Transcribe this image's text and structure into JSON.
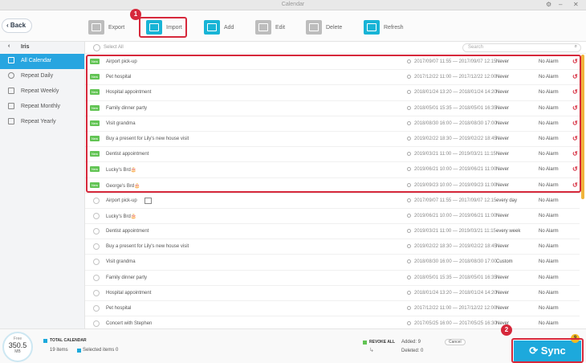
{
  "window": {
    "title": "Calendar"
  },
  "toolbar": {
    "back": "Back",
    "export": "Export",
    "import": "Import",
    "add": "Add",
    "edit": "Edit",
    "delete": "Delete",
    "refresh": "Refresh"
  },
  "badges": {
    "one": "1",
    "two": "2"
  },
  "sidebar": {
    "account": "Iris",
    "items": [
      {
        "label": "All Calendar"
      },
      {
        "label": "Repeat Daily"
      },
      {
        "label": "Repeat Weekly"
      },
      {
        "label": "Repeat Monthly"
      },
      {
        "label": "Repeat Yearly"
      }
    ]
  },
  "list": {
    "select_all": "Select All",
    "search_placeholder": "Search",
    "new_label": "New"
  },
  "rows": [
    {
      "title": "Airport pick-up",
      "dates": "2017/09/07 11:55 — 2017/09/07 12:15",
      "repeat": "Never",
      "alarm": "No Alarm",
      "isNew": true
    },
    {
      "title": "Pet hospital",
      "dates": "2017/12/22 11:00 — 2017/12/22 12:00",
      "repeat": "Never",
      "alarm": "No Alarm",
      "isNew": true
    },
    {
      "title": "Hospital appointment",
      "dates": "2018/01/24 13:20 — 2018/01/24 14:20",
      "repeat": "Never",
      "alarm": "No Alarm",
      "isNew": true
    },
    {
      "title": "Family dinner party",
      "dates": "2018/05/01 15:35 — 2018/05/01 16:35",
      "repeat": "Never",
      "alarm": "No Alarm",
      "isNew": true
    },
    {
      "title": "Visit grandma",
      "dates": "2018/08/30 16:00 — 2018/08/30 17:00",
      "repeat": "Never",
      "alarm": "No Alarm",
      "isNew": true
    },
    {
      "title": "Buy a present for Lily's new house visit",
      "dates": "2019/02/22 18:30 — 2019/02/22 18:45",
      "repeat": "Never",
      "alarm": "No Alarm",
      "isNew": true
    },
    {
      "title": "Dentist appointment",
      "dates": "2019/03/21 11:00 — 2019/03/21 11:15",
      "repeat": "Never",
      "alarm": "No Alarm",
      "isNew": true
    },
    {
      "title": "Lucky's Brd🎂",
      "dates": "2019/06/21 10:00 — 2019/06/21 11:00",
      "repeat": "Never",
      "alarm": "No Alarm",
      "isNew": true
    },
    {
      "title": "George's Brd🎂",
      "dates": "2019/09/23 10:00 — 2019/09/23 11:00",
      "repeat": "Never",
      "alarm": "No Alarm",
      "isNew": true
    },
    {
      "title": "Airport pick-up",
      "dates": "2017/09/07 11:55 — 2017/09/07 12:15",
      "repeat": "every day",
      "alarm": "No Alarm",
      "isNew": false,
      "calendarIcon": true
    },
    {
      "title": "Lucky's Brd🎂",
      "dates": "2019/06/21 10:00 — 2019/06/21 11:00",
      "repeat": "Never",
      "alarm": "No Alarm",
      "isNew": false
    },
    {
      "title": "Dentist appointment",
      "dates": "2019/03/21 11:00 — 2019/03/21 11:15",
      "repeat": "every week",
      "alarm": "No Alarm",
      "isNew": false
    },
    {
      "title": "Buy a present for Lily's new house visit",
      "dates": "2019/02/22 18:30 — 2019/02/22 18:45",
      "repeat": "Never",
      "alarm": "No Alarm",
      "isNew": false
    },
    {
      "title": "Visit grandma",
      "dates": "2018/08/30 16:00 — 2018/08/30 17:00",
      "repeat": "Custom",
      "alarm": "No Alarm",
      "isNew": false
    },
    {
      "title": "Family dinner party",
      "dates": "2018/05/01 15:35 — 2018/05/01 16:35",
      "repeat": "Never",
      "alarm": "No Alarm",
      "isNew": false
    },
    {
      "title": "Hospital appointment",
      "dates": "2018/01/24 13:20 — 2018/01/24 14:20",
      "repeat": "Never",
      "alarm": "No Alarm",
      "isNew": false
    },
    {
      "title": "Pet hospital",
      "dates": "2017/12/22 11:00 — 2017/12/22 12:00",
      "repeat": "Never",
      "alarm": "No Alarm",
      "isNew": false
    },
    {
      "title": "Concert with Stephen",
      "dates": "2017/05/25 16:00 — 2017/05/25 16:30",
      "repeat": "Never",
      "alarm": "No Alarm",
      "isNew": false
    }
  ],
  "footer": {
    "free_label": "Free",
    "free_value": "350.5",
    "free_unit": "MB",
    "total_label": "TOTAL CALENDAR",
    "items_text": "19 items",
    "selected_text": "Selected items 0",
    "revoke_label": "REVOKE ALL",
    "added_text": "Added: 9",
    "deleted_text": "Deleted: 0",
    "cancel": "Cancel"
  },
  "sync": {
    "label": "Sync",
    "count": "9"
  },
  "colors": {
    "accent": "#1da9dc",
    "highlight": "#d6283b",
    "new_badge": "#62c454"
  }
}
